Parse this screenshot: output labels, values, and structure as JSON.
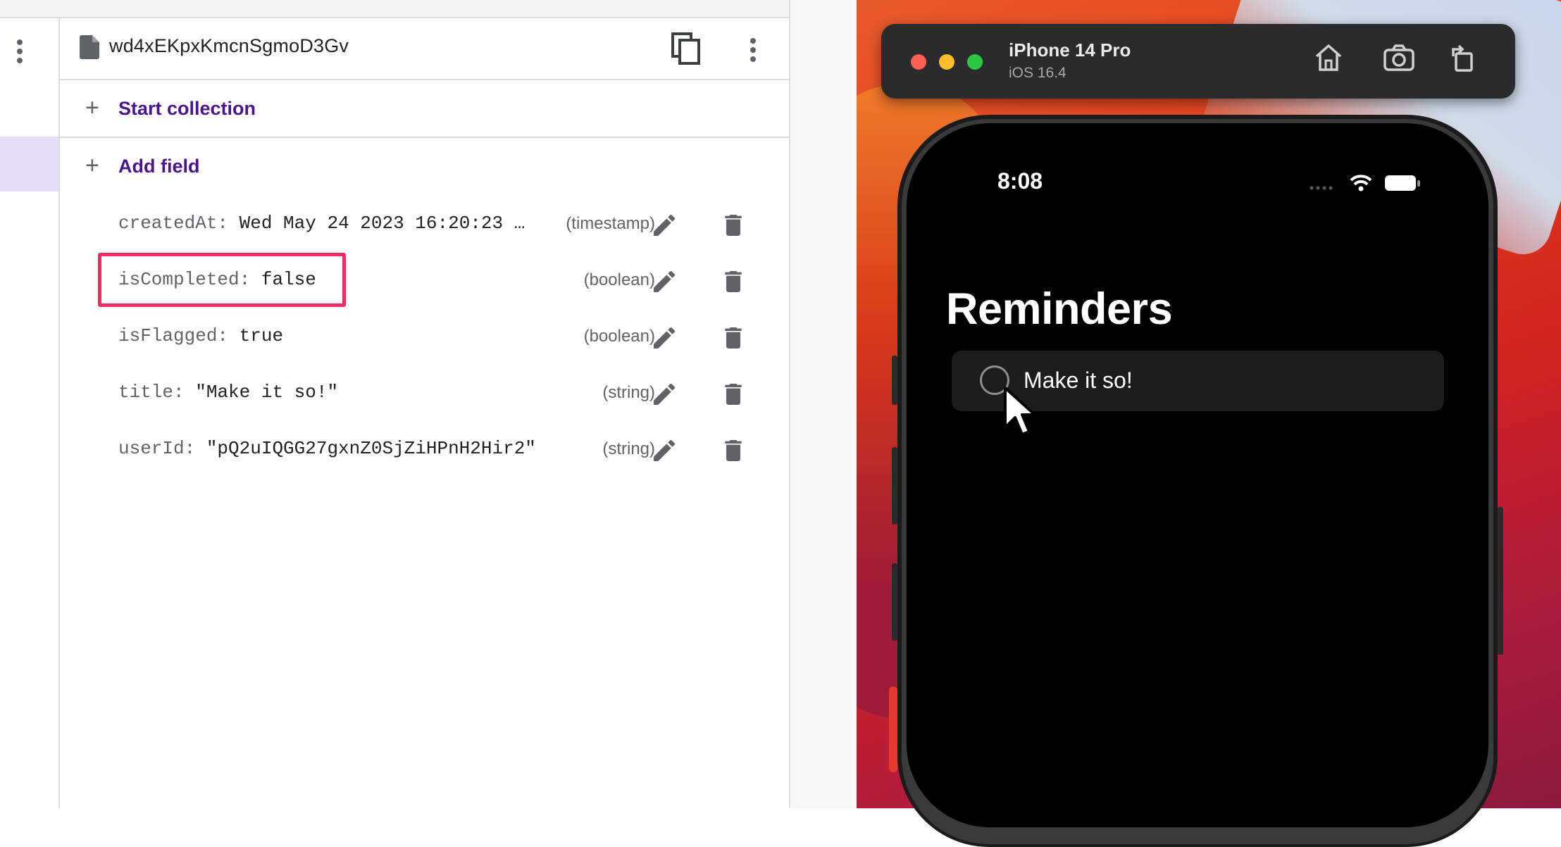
{
  "firestore": {
    "document_id": "wd4xEKpxKmcnSgmoD3Gv",
    "start_collection_label": "Start collection",
    "add_field_label": "Add field",
    "fields": [
      {
        "key": "createdAt:",
        "value": "Wed May 24 2023 16:20:23 …",
        "type": "(timestamp)"
      },
      {
        "key": "isCompleted:",
        "value": "false",
        "type": "(boolean)"
      },
      {
        "key": "isFlagged:",
        "value": "true",
        "type": "(boolean)"
      },
      {
        "key": "title:",
        "value": "\"Make it so!\"",
        "type": "(string)"
      },
      {
        "key": "userId:",
        "value": "\"pQ2uIQGG27gxnZ0SjZiHPnH2Hir2\"",
        "type": "(string)"
      }
    ],
    "highlight_color": "#ec2d63",
    "accent_color": "#4a148c"
  },
  "simulator": {
    "device_name": "iPhone 14 Pro",
    "os_version": "iOS 16.4",
    "toolbar_icons": [
      "home-icon",
      "screenshot-icon",
      "rotate-icon"
    ]
  },
  "phone": {
    "time": "8:08",
    "screen_title": "Reminders",
    "reminders": [
      {
        "title": "Make it so!",
        "completed": false
      }
    ]
  }
}
